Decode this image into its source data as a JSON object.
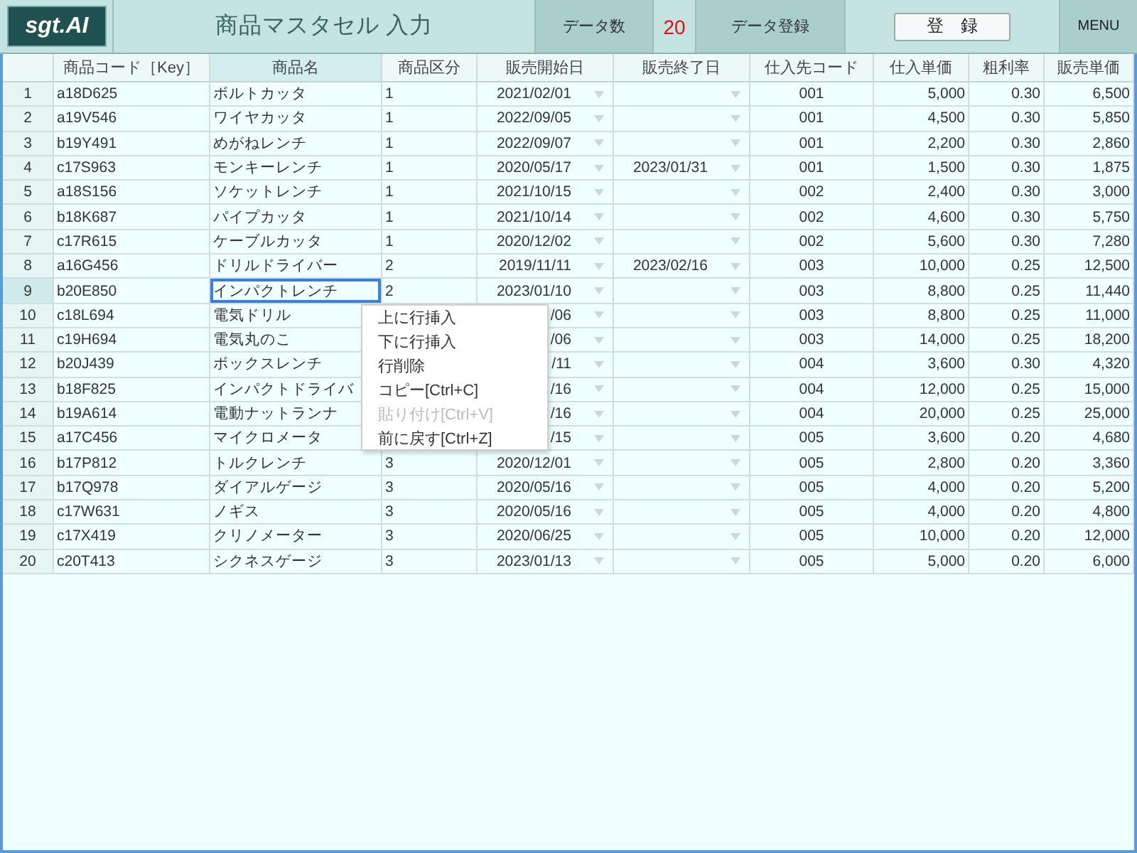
{
  "header": {
    "logo": "sgt.AI",
    "title": "商品マスタセル 入力",
    "count_label": "データ数",
    "count": "20",
    "register_label": "データ登録",
    "register_button": "登　録",
    "menu_button": "MENU"
  },
  "table": {
    "columns": [
      {
        "label": "商品コード［Key］",
        "kind": "text",
        "selected": false
      },
      {
        "label": "商品名",
        "kind": "text",
        "selected": true
      },
      {
        "label": "商品区分",
        "kind": "text",
        "selected": false
      },
      {
        "label": "販売開始日",
        "kind": "date",
        "selected": false
      },
      {
        "label": "販売終了日",
        "kind": "date",
        "selected": false
      },
      {
        "label": "仕入先コード",
        "kind": "code",
        "selected": false
      },
      {
        "label": "仕入単価",
        "kind": "number",
        "selected": false
      },
      {
        "label": "粗利率",
        "kind": "number",
        "selected": false
      },
      {
        "label": "販売単価",
        "kind": "number",
        "selected": false
      }
    ],
    "rows": [
      {
        "number": "1",
        "selected": false,
        "cells": [
          "a18D625",
          "ボルトカッタ",
          "1",
          "2021/02/01",
          null,
          "001",
          "5,000",
          "0.30",
          "6,500"
        ]
      },
      {
        "number": "2",
        "selected": false,
        "cells": [
          "a19V546",
          "ワイヤカッタ",
          "1",
          "2022/09/05",
          null,
          "001",
          "4,500",
          "0.30",
          "5,850"
        ]
      },
      {
        "number": "3",
        "selected": false,
        "cells": [
          "b19Y491",
          "めがねレンチ",
          "1",
          "2022/09/07",
          null,
          "001",
          "2,200",
          "0.30",
          "2,860"
        ]
      },
      {
        "number": "4",
        "selected": false,
        "cells": [
          "c17S963",
          "モンキーレンチ",
          "1",
          "2020/05/17",
          "2023/01/31",
          "001",
          "1,500",
          "0.30",
          "1,875"
        ]
      },
      {
        "number": "5",
        "selected": false,
        "cells": [
          "a18S156",
          "ソケットレンチ",
          "1",
          "2021/10/15",
          null,
          "002",
          "2,400",
          "0.30",
          "3,000"
        ]
      },
      {
        "number": "6",
        "selected": false,
        "cells": [
          "b18K687",
          "パイプカッタ",
          "1",
          "2021/10/14",
          null,
          "002",
          "4,600",
          "0.30",
          "5,750"
        ]
      },
      {
        "number": "7",
        "selected": false,
        "cells": [
          "c17R615",
          "ケーブルカッタ",
          "1",
          "2020/12/02",
          null,
          "002",
          "5,600",
          "0.30",
          "7,280"
        ]
      },
      {
        "number": "8",
        "selected": false,
        "cells": [
          "a16G456",
          "ドリルドライバー",
          "2",
          "2019/11/11",
          "2023/02/16",
          "003",
          "10,000",
          "0.25",
          "12,500"
        ]
      },
      {
        "number": "9",
        "selected": true,
        "cells": [
          "b20E850",
          "インパクトレンチ",
          "2",
          "2023/01/10",
          null,
          "003",
          "8,800",
          "0.25",
          "11,440"
        ]
      },
      {
        "number": "10",
        "selected": false,
        "cells": [
          "c18L694",
          "電気ドリル",
          null,
          "/06",
          null,
          "003",
          "8,800",
          "0.25",
          "11,000"
        ]
      },
      {
        "number": "11",
        "selected": false,
        "cells": [
          "c19H694",
          "電気丸のこ",
          null,
          "/06",
          null,
          "003",
          "14,000",
          "0.25",
          "18,200"
        ]
      },
      {
        "number": "12",
        "selected": false,
        "cells": [
          "b20J439",
          "ボックスレンチ",
          null,
          "/11",
          null,
          "004",
          "3,600",
          "0.30",
          "4,320"
        ]
      },
      {
        "number": "13",
        "selected": false,
        "cells": [
          "b18F825",
          "インパクトドライバ",
          null,
          "/16",
          null,
          "004",
          "12,000",
          "0.25",
          "15,000"
        ]
      },
      {
        "number": "14",
        "selected": false,
        "cells": [
          "b19A614",
          "電動ナットランナ",
          null,
          "/16",
          null,
          "004",
          "20,000",
          "0.25",
          "25,000"
        ]
      },
      {
        "number": "15",
        "selected": false,
        "cells": [
          "a17C456",
          "マイクロメータ",
          null,
          "/15",
          null,
          "005",
          "3,600",
          "0.20",
          "4,680"
        ]
      },
      {
        "number": "16",
        "selected": false,
        "cells": [
          "b17P812",
          "トルクレンチ",
          "3",
          "2020/12/01",
          null,
          "005",
          "2,800",
          "0.20",
          "3,360"
        ]
      },
      {
        "number": "17",
        "selected": false,
        "cells": [
          "b17Q978",
          "ダイアルゲージ",
          "3",
          "2020/05/16",
          null,
          "005",
          "4,000",
          "0.20",
          "5,200"
        ]
      },
      {
        "number": "18",
        "selected": false,
        "cells": [
          "c17W631",
          "ノギス",
          "3",
          "2020/05/16",
          null,
          "005",
          "4,000",
          "0.20",
          "4,800"
        ]
      },
      {
        "number": "19",
        "selected": false,
        "cells": [
          "c17X419",
          "クリノメーター",
          "3",
          "2020/06/25",
          null,
          "005",
          "10,000",
          "0.20",
          "12,000"
        ]
      },
      {
        "number": "20",
        "selected": false,
        "cells": [
          "c20T413",
          "シクネスゲージ",
          "3",
          "2023/01/13",
          null,
          "005",
          "5,000",
          "0.20",
          "6,000"
        ]
      }
    ]
  },
  "context_menu": {
    "items": [
      {
        "label": "上に行挿入",
        "disabled": false
      },
      {
        "label": "下に行挿入",
        "disabled": false
      },
      {
        "label": "行削除",
        "disabled": false
      },
      {
        "label": "コピー[Ctrl+C]",
        "disabled": false
      },
      {
        "label": "貼り付け[Ctrl+V]",
        "disabled": true
      },
      {
        "label": "前に戻す[Ctrl+Z]",
        "disabled": false
      }
    ]
  }
}
